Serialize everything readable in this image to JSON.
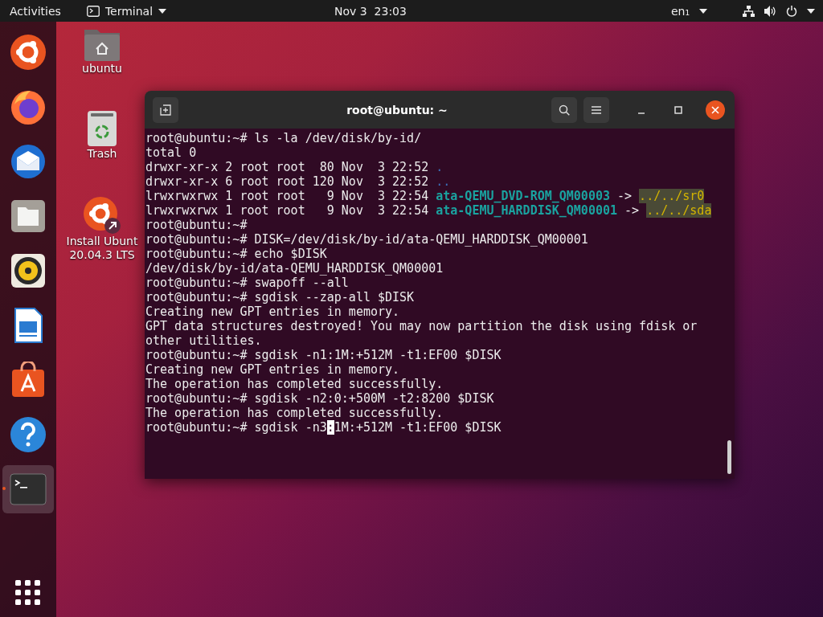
{
  "top_bar": {
    "activities": "Activities",
    "app_menu": {
      "label": "Terminal"
    },
    "clock": "Nov 3  23:03",
    "keyboard": "en₁"
  },
  "dock": {
    "items": [
      {
        "kind": "ubuntu-installer",
        "active": false
      },
      {
        "kind": "firefox",
        "active": false
      },
      {
        "kind": "thunderbird",
        "active": false
      },
      {
        "kind": "files",
        "active": false
      },
      {
        "kind": "rhythmbox",
        "active": false
      },
      {
        "kind": "writer",
        "active": false
      },
      {
        "kind": "software",
        "active": false
      },
      {
        "kind": "help",
        "active": false
      },
      {
        "kind": "terminal",
        "active": true
      }
    ]
  },
  "desktop_icons": [
    {
      "kind": "home",
      "label_lines": [
        "ubuntu"
      ]
    },
    {
      "kind": "trash",
      "label_lines": [
        "Trash"
      ]
    },
    {
      "kind": "installer",
      "label_lines": [
        "Install Ubunt",
        "20.04.3 LTS"
      ]
    }
  ],
  "window": {
    "title": "root@ubuntu: ~",
    "lines": [
      {
        "segments": [
          {
            "kind": "plain",
            "text": "root@ubuntu:~# ls -la /dev/disk/by-id/"
          }
        ]
      },
      {
        "segments": [
          {
            "kind": "plain",
            "text": "total 0"
          }
        ]
      },
      {
        "segments": [
          {
            "kind": "plain",
            "text": "drwxr-xr-x 2 root root  80 Nov  3 22:52 "
          },
          {
            "kind": "dir",
            "text": "."
          }
        ]
      },
      {
        "segments": [
          {
            "kind": "plain",
            "text": "drwxr-xr-x 6 root root 120 Nov  3 22:52 "
          },
          {
            "kind": "dir",
            "text": ".."
          }
        ]
      },
      {
        "segments": [
          {
            "kind": "plain",
            "text": "lrwxrwxrwx 1 root root   9 Nov  3 22:54 "
          },
          {
            "kind": "link",
            "text": "ata-QEMU_DVD-ROM_QM00003"
          },
          {
            "kind": "plain",
            "text": " -> "
          },
          {
            "kind": "target",
            "text": "../../sr0"
          }
        ]
      },
      {
        "segments": [
          {
            "kind": "plain",
            "text": "lrwxrwxrwx 1 root root   9 Nov  3 22:54 "
          },
          {
            "kind": "link",
            "text": "ata-QEMU_HARDDISK_QM00001"
          },
          {
            "kind": "plain",
            "text": " -> "
          },
          {
            "kind": "target",
            "text": "../../sda"
          }
        ]
      },
      {
        "segments": [
          {
            "kind": "plain",
            "text": "root@ubuntu:~#"
          }
        ]
      },
      {
        "segments": [
          {
            "kind": "plain",
            "text": "root@ubuntu:~# DISK=/dev/disk/by-id/ata-QEMU_HARDDISK_QM00001"
          }
        ]
      },
      {
        "segments": [
          {
            "kind": "plain",
            "text": "root@ubuntu:~# echo $DISK"
          }
        ]
      },
      {
        "segments": [
          {
            "kind": "plain",
            "text": "/dev/disk/by-id/ata-QEMU_HARDDISK_QM00001"
          }
        ]
      },
      {
        "segments": [
          {
            "kind": "plain",
            "text": "root@ubuntu:~# swapoff --all"
          }
        ]
      },
      {
        "segments": [
          {
            "kind": "plain",
            "text": "root@ubuntu:~# sgdisk --zap-all $DISK"
          }
        ]
      },
      {
        "segments": [
          {
            "kind": "plain",
            "text": "Creating new GPT entries in memory."
          }
        ]
      },
      {
        "segments": [
          {
            "kind": "plain",
            "text": "GPT data structures destroyed! You may now partition the disk using fdisk or"
          }
        ]
      },
      {
        "segments": [
          {
            "kind": "plain",
            "text": "other utilities."
          }
        ]
      },
      {
        "segments": [
          {
            "kind": "plain",
            "text": "root@ubuntu:~# sgdisk -n1:1M:+512M -t1:EF00 $DISK"
          }
        ]
      },
      {
        "segments": [
          {
            "kind": "plain",
            "text": "Creating new GPT entries in memory."
          }
        ]
      },
      {
        "segments": [
          {
            "kind": "plain",
            "text": "The operation has completed successfully."
          }
        ]
      },
      {
        "segments": [
          {
            "kind": "plain",
            "text": "root@ubuntu:~# sgdisk -n2:0:+500M -t2:8200 $DISK"
          }
        ]
      },
      {
        "segments": [
          {
            "kind": "plain",
            "text": "The operation has completed successfully."
          }
        ]
      },
      {
        "segments": [
          {
            "kind": "plain",
            "text": "root@ubuntu:~# sgdisk -n3"
          },
          {
            "kind": "cursor",
            "text": ":"
          },
          {
            "kind": "plain",
            "text": "1M:+512M -t1:EF00 $DISK"
          }
        ]
      }
    ]
  }
}
